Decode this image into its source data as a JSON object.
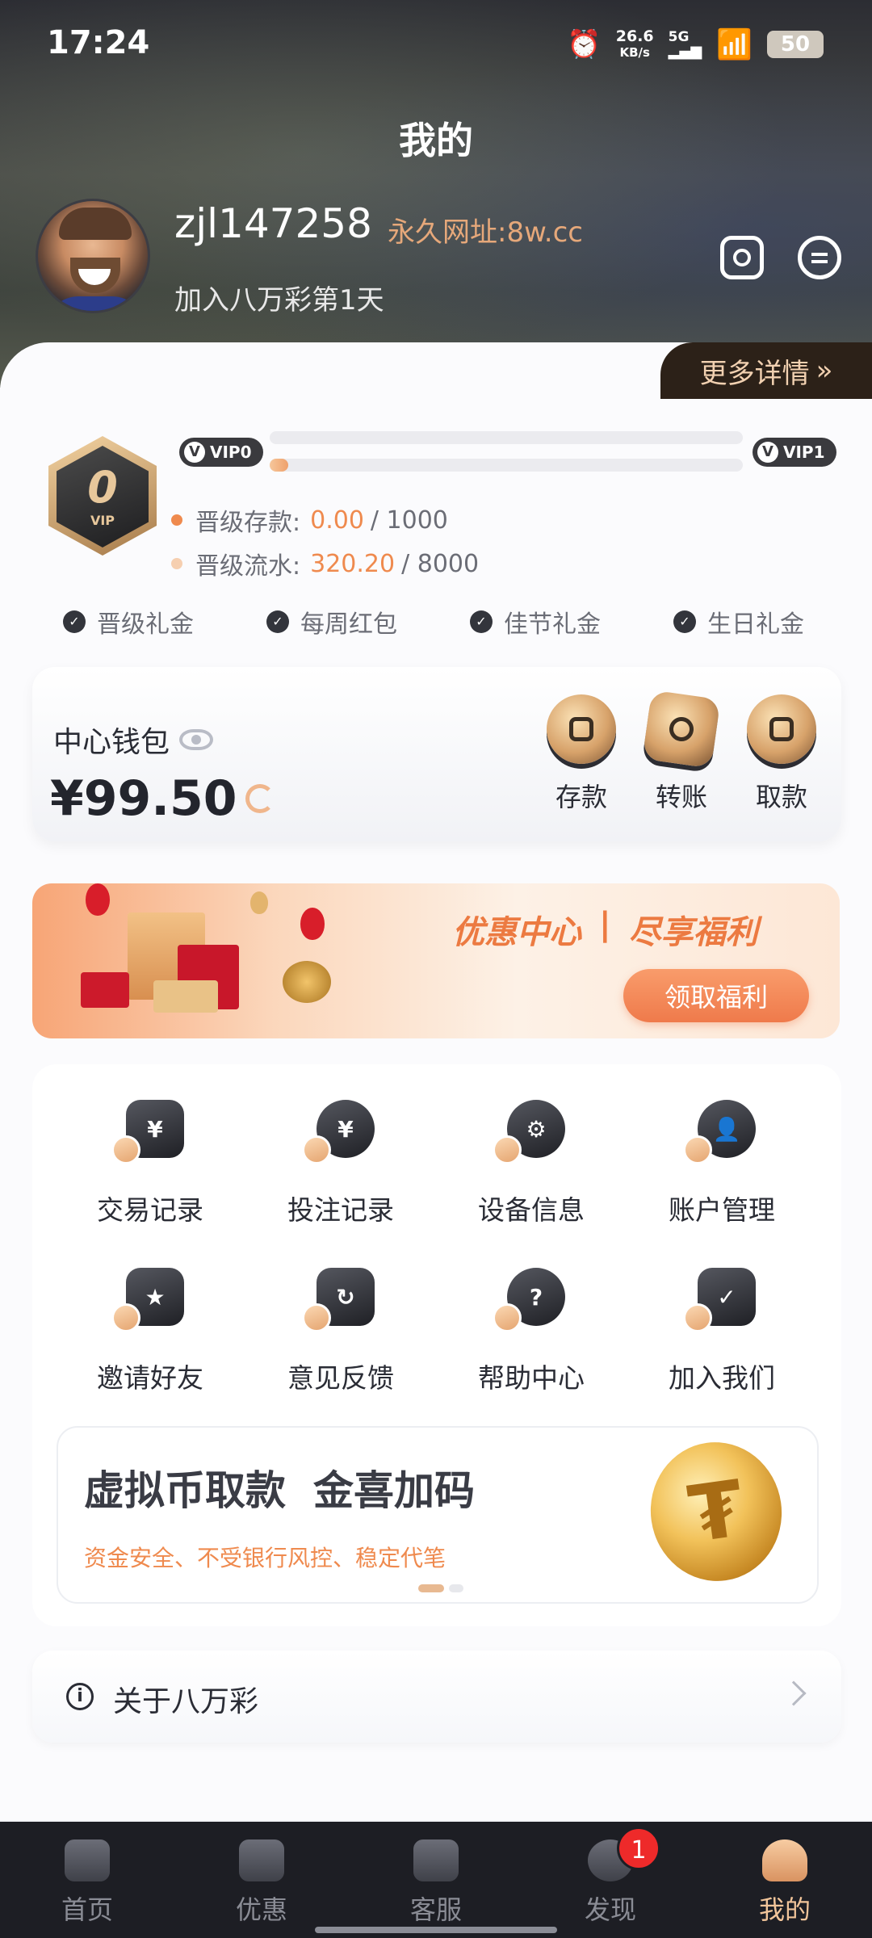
{
  "status_bar": {
    "time": "17:24",
    "net_speed_value": "26.6",
    "net_speed_unit": "KB/s",
    "network_type": "5G",
    "battery": "50"
  },
  "header": {
    "title": "我的",
    "username": "zjl147258",
    "permanent_url": "永久网址:8w.cc",
    "join_text": "加入八万彩第1天",
    "more_details": "更多详情",
    "more_details_arrow": "»"
  },
  "vip": {
    "badge_text": "0",
    "badge_sub": "VIP",
    "current_level": "VIP0",
    "next_level": "VIP1",
    "deposit_label": "晋级存款:",
    "deposit_value": "0.00",
    "deposit_target": "/ 1000",
    "deposit_progress": 0.0,
    "turnover_label": "晋级流水:",
    "turnover_value": "320.20",
    "turnover_target": "/ 8000",
    "turnover_progress": 0.04,
    "perks": [
      "晋级礼金",
      "每周红包",
      "佳节礼金",
      "生日礼金"
    ]
  },
  "wallet": {
    "label": "中心钱包",
    "amount": "¥99.50",
    "actions": [
      {
        "label": "存款",
        "icon": "deposit-icon"
      },
      {
        "label": "转账",
        "icon": "transfer-icon"
      },
      {
        "label": "取款",
        "icon": "withdraw-icon"
      }
    ]
  },
  "promo": {
    "title_left": "优惠中心",
    "separator": "|",
    "title_right": "尽享福利",
    "button": "领取福利"
  },
  "features": [
    {
      "label": "交易记录",
      "icon": "transaction-record-icon",
      "glyph": "¥"
    },
    {
      "label": "投注记录",
      "icon": "bet-record-icon",
      "glyph": "¥"
    },
    {
      "label": "设备信息",
      "icon": "device-info-icon",
      "glyph": "⚙"
    },
    {
      "label": "账户管理",
      "icon": "account-manage-icon",
      "glyph": "👤"
    },
    {
      "label": "邀请好友",
      "icon": "invite-friends-icon",
      "glyph": "★"
    },
    {
      "label": "意见反馈",
      "icon": "feedback-icon",
      "glyph": "↻"
    },
    {
      "label": "帮助中心",
      "icon": "help-center-icon",
      "glyph": "?"
    },
    {
      "label": "加入我们",
      "icon": "join-us-icon",
      "glyph": "✓"
    }
  ],
  "crypto_banner": {
    "title_a": "虚拟币取款",
    "title_b": "金喜加码",
    "subtitle": "资金安全、不受银行风控、稳定代笔",
    "coin_symbol": "₮"
  },
  "about": {
    "label": "关于八万彩",
    "info_glyph": "i"
  },
  "tabbar": {
    "tabs": [
      {
        "label": "首页",
        "icon": "home-icon"
      },
      {
        "label": "优惠",
        "icon": "promotion-icon"
      },
      {
        "label": "客服",
        "icon": "customer-service-icon"
      },
      {
        "label": "发现",
        "icon": "discover-icon"
      },
      {
        "label": "我的",
        "icon": "profile-icon"
      }
    ],
    "active_index": 4,
    "discover_badge": "1"
  },
  "colors": {
    "accent": "#ef8a4e",
    "gold": "#e6a87a",
    "dark": "#1d1e24"
  }
}
